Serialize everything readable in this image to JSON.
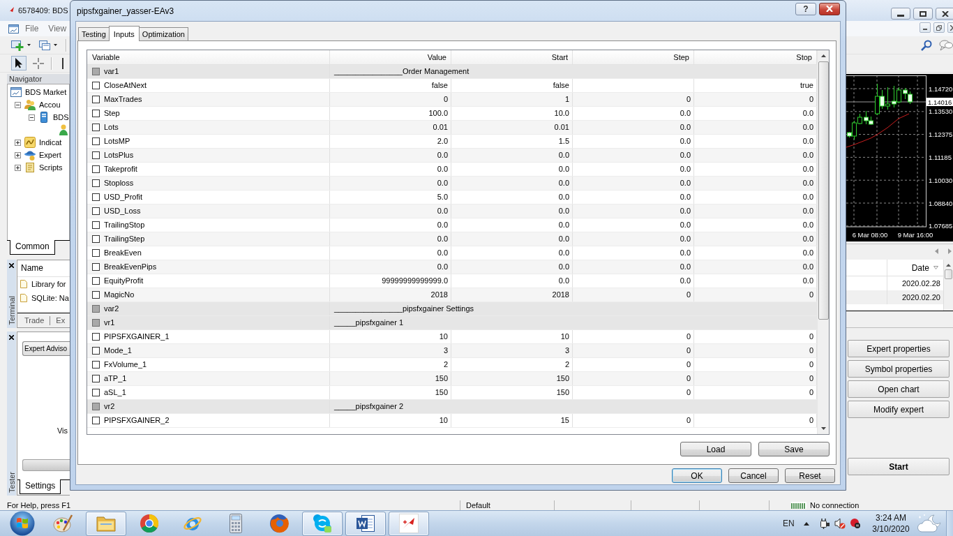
{
  "app": {
    "title": "6578409: BDS",
    "menu": [
      "File",
      "View"
    ],
    "navigator": {
      "title": "Navigator",
      "tree": [
        {
          "kind": "root",
          "label": "BDS Market",
          "children": [
            {
              "kind": "accounts",
              "label": "Accou",
              "expanded": true,
              "children": [
                {
                  "kind": "server",
                  "label": "BDS",
                  "expanded": true,
                  "children": [
                    {
                      "kind": "account"
                    }
                  ]
                }
              ]
            },
            {
              "kind": "indicators",
              "label": "Indicat",
              "expanded": false
            },
            {
              "kind": "experts",
              "label": "Expert",
              "expanded": false
            },
            {
              "kind": "scripts",
              "label": "Scripts",
              "expanded": false
            }
          ]
        }
      ],
      "tabs": [
        {
          "label": "Common",
          "selected": true
        }
      ]
    },
    "chart": {
      "price_labels": [
        "1.14720",
        "1.13530",
        "1.12375",
        "1.11185",
        "1.10030",
        "1.08840",
        "1.07685"
      ],
      "current_price": "1.14016",
      "time_labels": [
        "6 Mar 08:00",
        "9 Mar 16:00"
      ]
    },
    "terminal": {
      "title": "Terminal",
      "columns": [
        "Name",
        "Date"
      ],
      "rows": [
        {
          "name": "Library for",
          "date": "2020.02.28"
        },
        {
          "name": "SQLite: Na",
          "date": "2020.02.20"
        }
      ],
      "tabs": [
        "Trade",
        "Ex"
      ]
    },
    "tester": {
      "title": "Tester",
      "expert": "Expert Adviso",
      "visual_label": "Vis",
      "tabs": [
        {
          "label": "Settings",
          "selected": true
        }
      ],
      "buttons": [
        "Expert properties",
        "Symbol properties",
        "Open chart",
        "Modify expert"
      ],
      "start_button": "Start"
    }
  },
  "dialog": {
    "title": "pipsfxgainer_yasser-EAv3",
    "help_button": "?",
    "tabs": [
      {
        "label": "Testing",
        "selected": false
      },
      {
        "label": "Inputs",
        "selected": true
      },
      {
        "label": "Optimization",
        "selected": false
      }
    ],
    "table": {
      "columns": [
        "Variable",
        "Value",
        "Start",
        "Step",
        "Stop"
      ],
      "rows": [
        {
          "kind": "group",
          "name": "var1",
          "checked": false,
          "value": "________________Order Management"
        },
        {
          "kind": "field",
          "name": "CloseAtNext",
          "checked": false,
          "value": "false",
          "start": "false",
          "stop": "true"
        },
        {
          "kind": "field",
          "name": "MaxTrades",
          "checked": false,
          "value": "0",
          "start": "1",
          "step": "0",
          "stop": "0"
        },
        {
          "kind": "field",
          "name": "Step",
          "checked": false,
          "value": "100.0",
          "start": "10.0",
          "step": "0.0",
          "stop": "0.0"
        },
        {
          "kind": "field",
          "name": "Lots",
          "checked": false,
          "value": "0.01",
          "start": "0.01",
          "step": "0.0",
          "stop": "0.0"
        },
        {
          "kind": "field",
          "name": "LotsMP",
          "checked": false,
          "value": "2.0",
          "start": "1.5",
          "step": "0.0",
          "stop": "0.0"
        },
        {
          "kind": "field",
          "name": "LotsPlus",
          "checked": false,
          "value": "0.0",
          "start": "0.0",
          "step": "0.0",
          "stop": "0.0"
        },
        {
          "kind": "field",
          "name": "Takeprofit",
          "checked": false,
          "value": "0.0",
          "start": "0.0",
          "step": "0.0",
          "stop": "0.0"
        },
        {
          "kind": "field",
          "name": "Stoploss",
          "checked": false,
          "value": "0.0",
          "start": "0.0",
          "step": "0.0",
          "stop": "0.0"
        },
        {
          "kind": "field",
          "name": "USD_Profit",
          "checked": false,
          "value": "5.0",
          "start": "0.0",
          "step": "0.0",
          "stop": "0.0"
        },
        {
          "kind": "field",
          "name": "USD_Loss",
          "checked": false,
          "value": "0.0",
          "start": "0.0",
          "step": "0.0",
          "stop": "0.0"
        },
        {
          "kind": "field",
          "name": "TrailingStop",
          "checked": false,
          "value": "0.0",
          "start": "0.0",
          "step": "0.0",
          "stop": "0.0"
        },
        {
          "kind": "field",
          "name": "TrailingStep",
          "checked": false,
          "value": "0.0",
          "start": "0.0",
          "step": "0.0",
          "stop": "0.0"
        },
        {
          "kind": "field",
          "name": "BreakEven",
          "checked": false,
          "value": "0.0",
          "start": "0.0",
          "step": "0.0",
          "stop": "0.0"
        },
        {
          "kind": "field",
          "name": "BreakEvenPips",
          "checked": false,
          "value": "0.0",
          "start": "0.0",
          "step": "0.0",
          "stop": "0.0"
        },
        {
          "kind": "field",
          "name": "EquityProfit",
          "checked": false,
          "value": "99999999999999.0",
          "start": "0.0",
          "step": "0.0",
          "stop": "0.0"
        },
        {
          "kind": "field",
          "name": "MagicNo",
          "checked": false,
          "value": "2018",
          "start": "2018",
          "step": "0",
          "stop": "0"
        },
        {
          "kind": "group",
          "name": "var2",
          "checked": false,
          "value": "________________pipsfxgainer Settings"
        },
        {
          "kind": "group",
          "name": "vr1",
          "checked": false,
          "value": "_____pipsfxgainer 1"
        },
        {
          "kind": "field",
          "name": "PIPSFXGAINER_1",
          "checked": false,
          "value": "10",
          "start": "10",
          "step": "0",
          "stop": "0"
        },
        {
          "kind": "field",
          "name": "Mode_1",
          "checked": false,
          "value": "3",
          "start": "3",
          "step": "0",
          "stop": "0"
        },
        {
          "kind": "field",
          "name": "FxVolume_1",
          "checked": false,
          "value": "2",
          "start": "2",
          "step": "0",
          "stop": "0"
        },
        {
          "kind": "field",
          "name": "aTP_1",
          "checked": false,
          "value": "150",
          "start": "150",
          "step": "0",
          "stop": "0"
        },
        {
          "kind": "field",
          "name": "aSL_1",
          "checked": false,
          "value": "150",
          "start": "150",
          "step": "0",
          "stop": "0"
        },
        {
          "kind": "group",
          "name": "vr2",
          "checked": false,
          "value": "_____pipsfxgainer 2"
        },
        {
          "kind": "field",
          "name": "PIPSFXGAINER_2",
          "checked": false,
          "value": "10",
          "start": "15",
          "step": "0",
          "stop": "0"
        }
      ]
    },
    "file_buttons": [
      "Load",
      "Save"
    ],
    "buttons": [
      {
        "label": "OK",
        "default": true
      },
      {
        "label": "Cancel",
        "default": false
      },
      {
        "label": "Reset",
        "default": false
      }
    ]
  },
  "status_bar": [
    "For Help, press F1",
    "Default",
    "No connection"
  ],
  "taskbar": {
    "apps": [
      {
        "kind": "palette",
        "open": false
      },
      {
        "kind": "folder",
        "open": true
      },
      {
        "kind": "wheel",
        "open": false
      },
      {
        "kind": "orbit",
        "open": false
      },
      {
        "kind": "calculator",
        "open": false
      },
      {
        "kind": "globe",
        "open": false
      },
      {
        "kind": "cloud",
        "open": true
      },
      {
        "kind": "document",
        "open": true
      },
      {
        "kind": "arrow",
        "open": true
      }
    ],
    "language": "EN",
    "time": "3:24 AM",
    "date": "3/10/2020"
  }
}
